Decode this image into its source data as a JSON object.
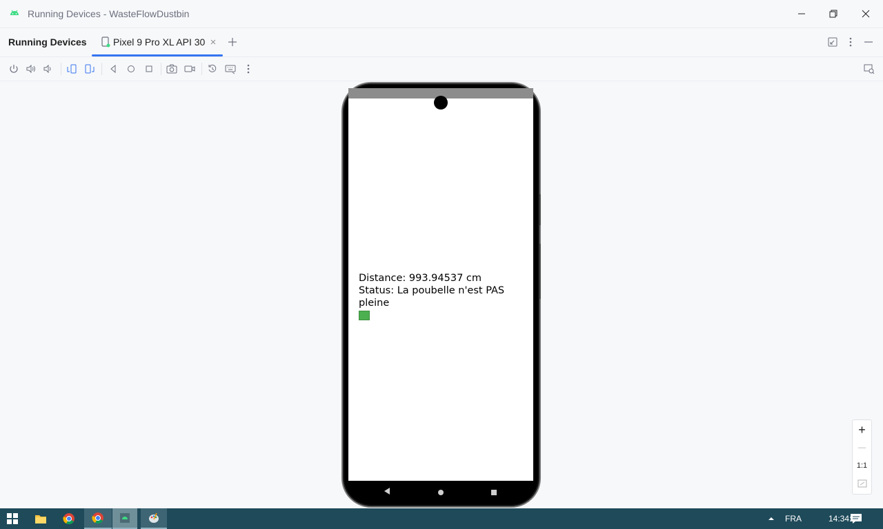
{
  "window": {
    "title": "Running Devices - WasteFlowDustbin",
    "icon": "android-icon"
  },
  "toolwindow": {
    "title": "Running Devices",
    "tab_label": "Pixel 9 Pro XL API 30"
  },
  "toolbar": {
    "icons": [
      "power-icon",
      "volume-up-icon",
      "volume-down-icon",
      "rotate-left-icon",
      "rotate-right-icon",
      "back-icon",
      "home-icon",
      "overview-icon",
      "screenshot-icon",
      "screen-record-icon",
      "reset-icon",
      "keyboard-icon",
      "more-icon"
    ]
  },
  "app": {
    "distance_text": "Distance: 993.94537 cm",
    "status_text": "Status: La poubelle n'est PAS pleine",
    "status_color": "#4caf50"
  },
  "zoom": {
    "plus": "+",
    "minus": "—",
    "actual": "1:1"
  },
  "taskbar": {
    "language": "FRA",
    "time": "14:34:49"
  },
  "colors": {
    "accent": "#3574f0",
    "taskbar": "#1f4a5a",
    "android_green": "#3ddc84"
  }
}
